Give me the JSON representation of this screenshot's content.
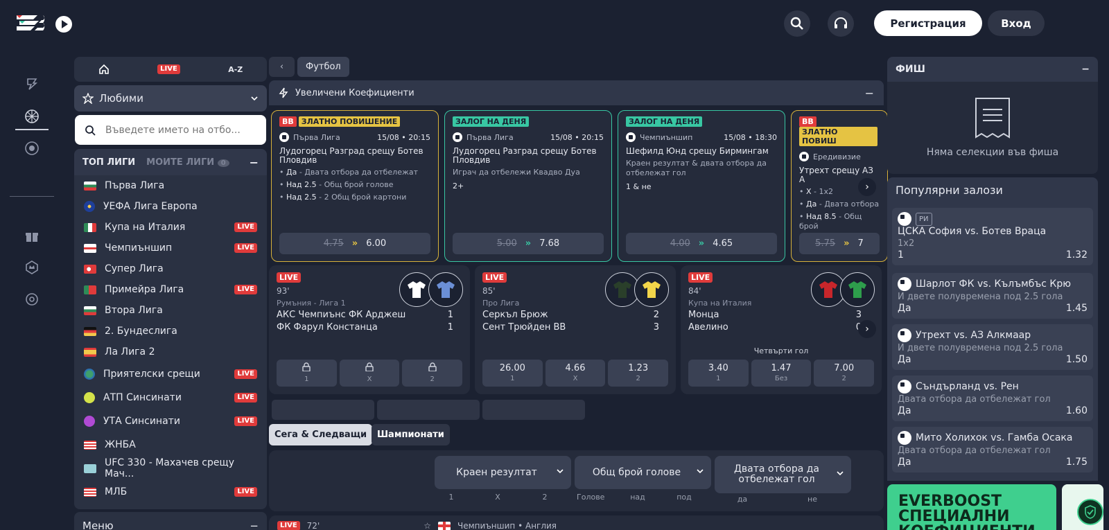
{
  "header": {
    "register_label": "Регистрация",
    "login_label": "Вход"
  },
  "sidebar": {
    "tabs": {
      "live": "LIVE",
      "az": "A-Z"
    },
    "favorites_label": "Любими",
    "search_placeholder": "Въведете името на отбо...",
    "top_leagues_label": "ТОП ЛИГИ",
    "my_leagues_label": "МОИТЕ ЛИГИ",
    "my_leagues_count": "0",
    "leagues": [
      {
        "name": "Първа Лига",
        "live": ""
      },
      {
        "name": "УЕФА Лига Европа",
        "live": ""
      },
      {
        "name": "Купа на Италия",
        "live": "LIVE"
      },
      {
        "name": "Чемпиъншип",
        "live": "LIVE"
      },
      {
        "name": "Супер Лига",
        "live": ""
      },
      {
        "name": "Примейра Лига",
        "live": "LIVE"
      },
      {
        "name": "Втора Лига",
        "live": ""
      },
      {
        "name": "2. Бундеслига",
        "live": ""
      },
      {
        "name": "Ла Лига 2",
        "live": ""
      },
      {
        "name": "Приятелски срещи",
        "live": "LIVE"
      },
      {
        "name": "АТП Синсинати",
        "live": "LIVE"
      },
      {
        "name": "УТА Синсинати",
        "live": "LIVE"
      },
      {
        "name": "ЖНБА",
        "live": ""
      },
      {
        "name": "UFC 330 - Махачев срещу Мач...",
        "live": ""
      },
      {
        "name": "МЛБ",
        "live": "LIVE"
      }
    ],
    "menu_label": "Меню"
  },
  "main": {
    "breadcrumb": "Футбол",
    "boost_title": "Увеличени Коефициенти",
    "boost_cards": [
      {
        "tags": [
          "BB",
          "ЗЛАТНО ПОВИШЕНИЕ"
        ],
        "league": "Първа Лига",
        "datetime": "15/08 • 20:15",
        "title": "Лудогорец Разград срещу Ботев Пловдив",
        "lines": [
          {
            "a": "Да",
            "b": "Двата отбора да отбележат"
          },
          {
            "a": "Над 2.5",
            "b": "Общ брой голове"
          },
          {
            "a": "Над 2.5",
            "b": "2 Общ брой картони"
          }
        ],
        "old_odds": "4.75",
        "new_odds": "6.00"
      },
      {
        "tags": [
          "ЗАЛОГ НА ДЕНЯ"
        ],
        "league": "Първа Лига",
        "datetime": "15/08 • 20:15",
        "title": "Лудогорец Разград срещу Ботев Пловдив",
        "sub": "Играч да отбележи Квадво Дуа",
        "pick": "2+",
        "old_odds": "5.00",
        "new_odds": "7.68"
      },
      {
        "tags": [
          "ЗАЛОГ НА ДЕНЯ"
        ],
        "league": "Чемпиъншип",
        "datetime": "15/08 • 18:30",
        "title": "Шефилд Юнд срещу Бирмингам",
        "sub": "Краен резултат & двата отбора да отбележат гол",
        "pick": "1 & не",
        "old_odds": "4.00",
        "new_odds": "4.65"
      },
      {
        "tags": [
          "BB",
          "ЗЛАТНО ПОВИШ"
        ],
        "league": "Ередивизие",
        "datetime": "",
        "title": "Утрехт срещу АЗ А",
        "lines": [
          {
            "a": "X",
            "b": "1x2"
          },
          {
            "a": "Да",
            "b": "Двата отбора"
          },
          {
            "a": "Над 8.5",
            "b": "Общ брой"
          }
        ],
        "old_odds": "5.75",
        "new_odds": "7"
      }
    ],
    "live_matches": [
      {
        "badge": "LIVE",
        "minute": "93'",
        "league": "Румъния - Лига 1",
        "home": "АКС Чемпиънс ФК Арджеш",
        "home_score": "1",
        "away": "ФК Фарул Констанца",
        "away_score": "1",
        "market": "",
        "odds": [
          {
            "v": "",
            "l": "1"
          },
          {
            "v": "",
            "l": "X"
          },
          {
            "v": "",
            "l": "2"
          }
        ],
        "locked": true
      },
      {
        "badge": "LIVE",
        "minute": "85'",
        "league": "Про Лига",
        "home": "Серкъл Брюж",
        "home_score": "2",
        "away": "Сент Трюйден ВВ",
        "away_score": "3",
        "market": "",
        "odds": [
          {
            "v": "26.00",
            "l": "1"
          },
          {
            "v": "4.66",
            "l": "X"
          },
          {
            "v": "1.23",
            "l": "2"
          }
        ],
        "locked": false
      },
      {
        "badge": "LIVE",
        "minute": "84'",
        "league": "Купа на Италия",
        "home": "Монца",
        "home_score": "3",
        "away": "Авелино",
        "away_score": "0",
        "market": "Четвърти гол",
        "odds": [
          {
            "v": "3.40",
            "l": "1"
          },
          {
            "v": "1.47",
            "l": "Без"
          },
          {
            "v": "7.00",
            "l": "2"
          }
        ],
        "locked": false
      }
    ],
    "segments": {
      "now_next": "Сега & Следващи",
      "championships": "Шампионати"
    },
    "markets": {
      "m1": "Краен резултат",
      "m2": "Общ брой голове",
      "m3": "Двата отбора да отбележат гол",
      "cols": [
        "1",
        "X",
        "2",
        "Голове",
        "над",
        "под",
        "да",
        "не"
      ]
    },
    "next_row": {
      "badge": "LIVE",
      "minute": "72'",
      "league": "Чемпиъншип • Англия"
    }
  },
  "betslip": {
    "title": "ФИШ",
    "empty_text": "Няма селекции във фиша"
  },
  "popular": {
    "title": "Популярни залози",
    "items": [
      {
        "tag": "РИ",
        "match": "ЦСКА София vs. Ботев Враца",
        "market": "1x2",
        "pick": "1",
        "odds": "1.32"
      },
      {
        "tag": "",
        "match": "Шарлот ФК vs. Кълъмбъс Крю",
        "market": "И двете полувремена под 2.5 гола",
        "pick": "Да",
        "odds": "1.45"
      },
      {
        "tag": "",
        "match": "Утрехт vs. АЗ Алкмаар",
        "market": "И двете полувремена под 2.5 гола",
        "pick": "Да",
        "odds": "1.50"
      },
      {
        "tag": "",
        "match": "Съндърланд vs. Рен",
        "market": "Двата отбора да отбележат гол",
        "pick": "Да",
        "odds": "1.60"
      },
      {
        "tag": "",
        "match": "Мито Холихок vs. Гамба Осака",
        "market": "Двата отбора да отбележат гол",
        "pick": "Да",
        "odds": "1.75"
      }
    ]
  },
  "banner": {
    "line1": "EVERBOOST",
    "line2": "СПЕЦИАЛНИ",
    "line3": "КОЕФИЦИЕНТИ"
  },
  "colors": {
    "background": "#1b2131",
    "panel": "#2a3142",
    "live": "#e03b3b",
    "gold": "#e5c343",
    "green": "#38c7a3",
    "banner": "#3fcf8e"
  }
}
